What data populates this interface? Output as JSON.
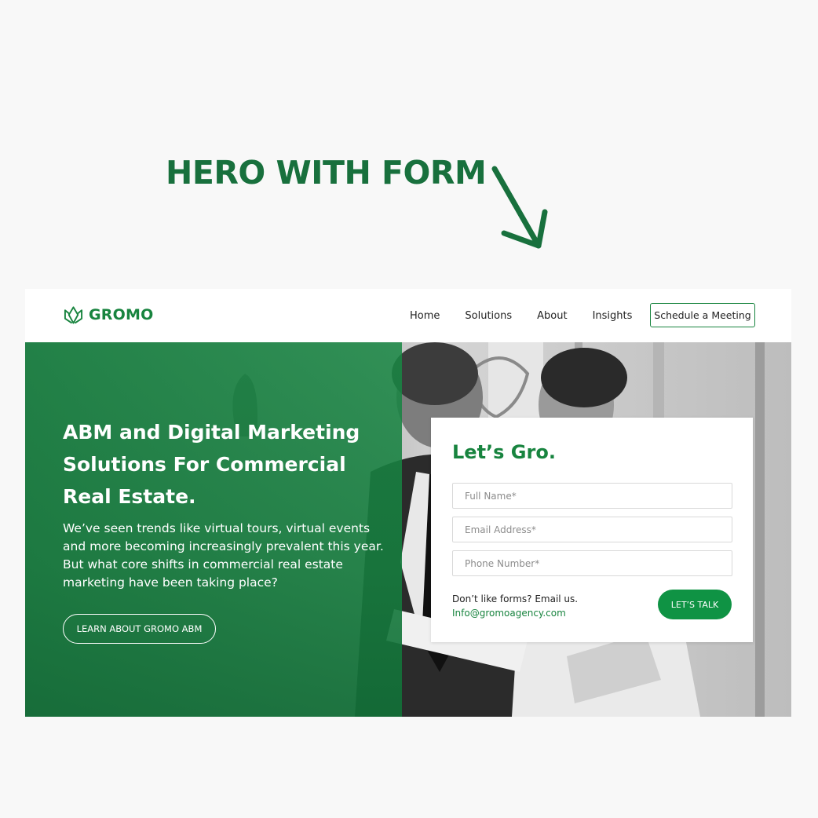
{
  "annotation": {
    "title": "HERO WITH FORM",
    "arrow_icon": "arrow-down-right-icon"
  },
  "colors": {
    "brand_green": "#18843f",
    "button_green": "#0f9344",
    "annotation_green": "#18703d"
  },
  "nav": {
    "logo_text": "GROMO",
    "logo_icon": "leaf-crown-icon",
    "links": [
      "Home",
      "Solutions",
      "About",
      "Insights"
    ],
    "cta_label": "Schedule a Meeting"
  },
  "hero": {
    "heading": "ABM and Digital Marketing Solutions For Commercial Real Estate.",
    "body": "We’ve seen trends like virtual tours, virtual events and more becoming increasingly prevalent this year. But what core shifts in commercial real estate marketing have been taking place?",
    "button_label": "LEARN ABOUT GROMO ABM"
  },
  "form": {
    "title": "Let’s Gro.",
    "fields": [
      {
        "placeholder": "Full Name*",
        "value": ""
      },
      {
        "placeholder": "Email Address*",
        "value": ""
      },
      {
        "placeholder": "Phone Number*",
        "value": ""
      }
    ],
    "note": "Don’t like forms? Email us.",
    "email": "Info@gromoagency.com",
    "submit_label": "LET’S TALK"
  }
}
